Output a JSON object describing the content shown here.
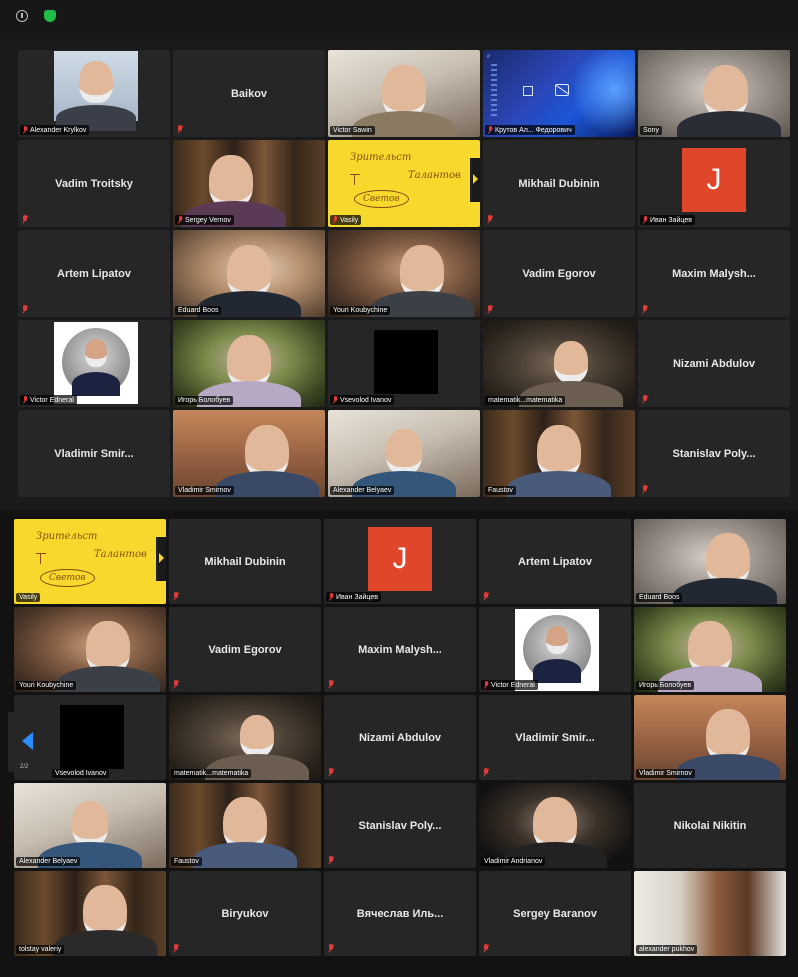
{
  "top_bar": {
    "info_icon": "info-icon",
    "shield_icon": "shield-icon",
    "shield_color": "#1fbd4a"
  },
  "colors": {
    "active_speaker_border": "#2fd06a",
    "muted_mic": "#e03a3a",
    "nav_arrow": "#2d8cff",
    "avatar_bg": "#e0462a"
  },
  "gallery1": {
    "r1": [
      {
        "name": "Alexander Krylkov",
        "muted": true
      },
      {
        "name": "Baikov",
        "muted": true
      },
      {
        "name": "Victor Sawin",
        "muted": false
      },
      {
        "name": "Крутов Ал... Федорович",
        "muted": true
      },
      {
        "name": "Sony",
        "muted": false
      }
    ],
    "r2": [
      {
        "name": "Vadim Troitsky",
        "muted": true
      },
      {
        "name": "Sergey Vernov",
        "muted": true
      },
      {
        "name": "Vasily",
        "muted": true,
        "wb1": "Зрительст",
        "wb2": "Талантов",
        "wb3": "Светов"
      },
      {
        "name": "Mikhail Dubinin",
        "muted": true
      },
      {
        "name": "Иван Зайцев",
        "muted": true,
        "initial": "J"
      }
    ],
    "r3": [
      {
        "name": "Artem Lipatov",
        "muted": true
      },
      {
        "name": "Eduard Boos",
        "muted": false
      },
      {
        "name": "Youri Koubychine",
        "muted": false
      },
      {
        "name": "Vadim Egorov",
        "muted": true
      },
      {
        "name": "Maxim Malysh...",
        "muted": true
      }
    ],
    "r4": [
      {
        "name": "Victor Edneral",
        "muted": true
      },
      {
        "name": "Игорь Болобуев",
        "muted": false
      },
      {
        "name": "Vsevolod Ivanov",
        "muted": true
      },
      {
        "name": "matematik...matematika",
        "muted": false
      },
      {
        "name": "Nizami Abdulov",
        "muted": true
      }
    ],
    "r5": [
      {
        "name": "Vladimir Smir...",
        "muted": false
      },
      {
        "name": "Vladimir Smirnov",
        "muted": false
      },
      {
        "name": "Alexander Belyaev",
        "muted": false
      },
      {
        "name": "Faustov",
        "muted": false
      },
      {
        "name": "Stanislav Poly...",
        "muted": true
      }
    ]
  },
  "gallery2": {
    "r1": [
      {
        "name": "Vasily",
        "muted": false,
        "wb1": "Зрительст",
        "wb2": "Талантов",
        "wb3": "Светов"
      },
      {
        "name": "Mikhail Dubinin",
        "muted": true
      },
      {
        "name": "Иван Зайцев",
        "muted": true,
        "initial": "J"
      },
      {
        "name": "Artem Lipatov",
        "muted": true
      },
      {
        "name": "Eduard Boos",
        "muted": false
      }
    ],
    "r2": [
      {
        "name": "Youri Koubychine",
        "muted": false
      },
      {
        "name": "Vadim Egorov",
        "muted": true
      },
      {
        "name": "Maxim Malysh...",
        "muted": true
      },
      {
        "name": "Victor Edneral",
        "muted": true
      },
      {
        "name": "Игорь Болобуев",
        "muted": false
      }
    ],
    "r3": [
      {
        "name": "Vsevolod Ivanov",
        "muted": false
      },
      {
        "name": "matematik...matematika",
        "muted": false
      },
      {
        "name": "Nizami Abdulov",
        "muted": true
      },
      {
        "name": "Vladimir Smir...",
        "muted": true
      },
      {
        "name": "Vladimir Smirnov",
        "muted": false
      }
    ],
    "r4": [
      {
        "name": "Alexander Belyaev",
        "muted": false
      },
      {
        "name": "Faustov",
        "muted": false
      },
      {
        "name": "Stanislav Poly...",
        "muted": true
      },
      {
        "name": "Vladimir Andrianov",
        "muted": false
      },
      {
        "name": "Nikolai Nikitin",
        "muted": true
      }
    ],
    "r5": [
      {
        "name": "tolstay valeriy",
        "muted": false
      },
      {
        "name": "Biryukov",
        "muted": true
      },
      {
        "name": "Вячеслав Иль...",
        "muted": true
      },
      {
        "name": "Sergey Baranov",
        "muted": true
      },
      {
        "name": "alexander pukhov",
        "muted": false
      }
    ]
  },
  "pagination": {
    "indicator": "2/2",
    "prev_icon": "chevron-left-icon"
  }
}
